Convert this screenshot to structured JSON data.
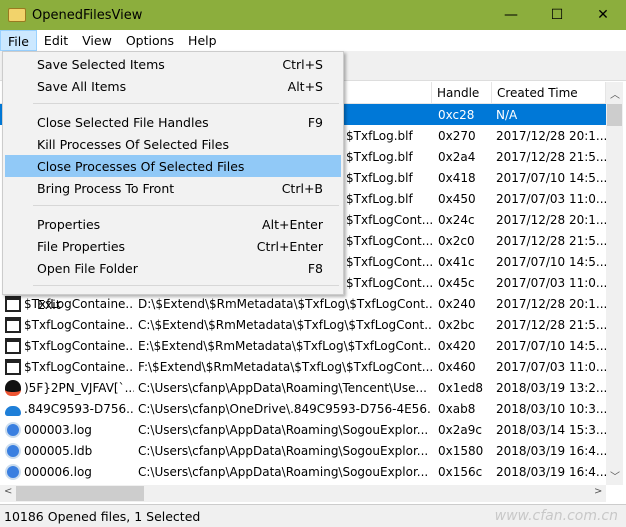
{
  "window": {
    "title": "OpenedFilesView",
    "minimize": "—",
    "maximize": "☐",
    "close": "✕"
  },
  "menubar": [
    "File",
    "Edit",
    "View",
    "Options",
    "Help"
  ],
  "file_menu": [
    {
      "label": "Save Selected Items",
      "shortcut": "Ctrl+S"
    },
    {
      "label": "Save All Items",
      "shortcut": "Alt+S"
    },
    {
      "sep": true
    },
    {
      "label": "Close Selected File Handles",
      "shortcut": "F9"
    },
    {
      "label": "Kill Processes Of Selected Files",
      "shortcut": ""
    },
    {
      "label": "Close Processes Of Selected Files",
      "shortcut": "",
      "highlighted": true
    },
    {
      "label": "Bring Process To Front",
      "shortcut": "Ctrl+B"
    },
    {
      "sep": true
    },
    {
      "label": "Properties",
      "shortcut": "Alt+Enter"
    },
    {
      "label": "File Properties",
      "shortcut": "Ctrl+Enter"
    },
    {
      "label": "Open File Folder",
      "shortcut": "F8"
    },
    {
      "sep": true
    },
    {
      "label": "Exit",
      "shortcut": ""
    }
  ],
  "columns": [
    "",
    "",
    "Handle",
    "Created Time"
  ],
  "rows": [
    {
      "icon": "none",
      "name": "",
      "path": "",
      "handle": "0xc28",
      "created": "N/A",
      "selected": true
    },
    {
      "icon": "none",
      "name": "",
      "path": "$TxfLog.blf",
      "handle": "0x270",
      "created": "2017/12/28 20:1..."
    },
    {
      "icon": "none",
      "name": "",
      "path": "$TxfLog.blf",
      "handle": "0x2a4",
      "created": "2017/12/28 21:5..."
    },
    {
      "icon": "none",
      "name": "",
      "path": "$TxfLog.blf",
      "handle": "0x418",
      "created": "2017/07/10 14:5..."
    },
    {
      "icon": "none",
      "name": "",
      "path": "$TxfLog.blf",
      "handle": "0x450",
      "created": "2017/07/03 11:0..."
    },
    {
      "icon": "none",
      "name": "",
      "path": "$TxfLogCont...",
      "handle": "0x24c",
      "created": "2017/12/28 20:1..."
    },
    {
      "icon": "none",
      "name": "",
      "path": "$TxfLogCont...",
      "handle": "0x2c0",
      "created": "2017/12/28 21:5..."
    },
    {
      "icon": "none",
      "name": "",
      "path": "$TxfLogCont...",
      "handle": "0x41c",
      "created": "2017/07/10 14:5..."
    },
    {
      "icon": "none",
      "name": "",
      "path": "$TxfLogCont...",
      "handle": "0x45c",
      "created": "2017/07/03 11:0..."
    },
    {
      "icon": "window",
      "name": "$TxfLogContaine...",
      "path": "D:\\$Extend\\$RmMetadata\\$TxfLog\\$TxfLogCont...",
      "handle": "0x240",
      "created": "2017/12/28 20:1..."
    },
    {
      "icon": "window",
      "name": "$TxfLogContaine...",
      "path": "C:\\$Extend\\$RmMetadata\\$TxfLog\\$TxfLogCont...",
      "handle": "0x2bc",
      "created": "2017/12/28 21:5..."
    },
    {
      "icon": "window",
      "name": "$TxfLogContaine...",
      "path": "E:\\$Extend\\$RmMetadata\\$TxfLog\\$TxfLogCont...",
      "handle": "0x420",
      "created": "2017/07/10 14:5..."
    },
    {
      "icon": "window",
      "name": "$TxfLogContaine...",
      "path": "F:\\$Extend\\$RmMetadata\\$TxfLog\\$TxfLogCont...",
      "handle": "0x460",
      "created": "2017/07/03 11:0..."
    },
    {
      "icon": "qq",
      "name": ")5F}2PN_VJFAV[`...",
      "path": "C:\\Users\\cfanp\\AppData\\Roaming\\Tencent\\Use...",
      "handle": "0x1ed8",
      "created": "2018/03/19 13:2..."
    },
    {
      "icon": "onedrive",
      "name": ".849C9593-D756...",
      "path": "C:\\Users\\cfanp\\OneDrive\\.849C9593-D756-4E56...",
      "handle": "0xab8",
      "created": "2018/03/10 10:3..."
    },
    {
      "icon": "sogou",
      "name": "000003.log",
      "path": "C:\\Users\\cfanp\\AppData\\Roaming\\SogouExplor...",
      "handle": "0x2a9c",
      "created": "2018/03/14 15:3..."
    },
    {
      "icon": "sogou",
      "name": "000005.ldb",
      "path": "C:\\Users\\cfanp\\AppData\\Roaming\\SogouExplor...",
      "handle": "0x1580",
      "created": "2018/03/19 16:4..."
    },
    {
      "icon": "sogou",
      "name": "000006.log",
      "path": "C:\\Users\\cfanp\\AppData\\Roaming\\SogouExplor...",
      "handle": "0x156c",
      "created": "2018/03/19 16:4..."
    }
  ],
  "status": "10186 Opened files, 1 Selected",
  "watermark": "www.cfan.com.cn"
}
